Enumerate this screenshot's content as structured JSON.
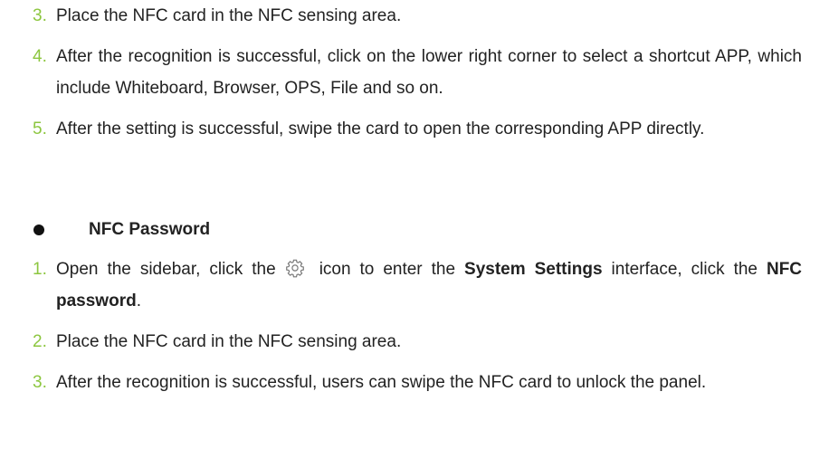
{
  "steps_before": [
    {
      "num": "3.",
      "text": "Place the NFC card in the NFC sensing area."
    },
    {
      "num": "4.",
      "text": "After the recognition is successful, click on the lower right corner to select a shortcut APP, which include Whiteboard, Browser, OPS, File and so on."
    },
    {
      "num": "5.",
      "text": "After the setting is successful, swipe the card to open the corresponding APP directly."
    }
  ],
  "section": {
    "title": "NFC Password"
  },
  "steps_after": {
    "s1": {
      "num": "1.",
      "pre": "Open the sidebar, click the",
      "icon": "gear-icon",
      "mid": "icon to enter the",
      "bold1": "System Settings",
      "post1": "interface, click the",
      "bold2": "NFC password",
      "end": "."
    },
    "s2": {
      "num": "2.",
      "text": "Place the NFC card in the NFC sensing area."
    },
    "s3": {
      "num": "3.",
      "text": "After the recognition is successful, users can swipe the NFC card to unlock the panel."
    }
  },
  "colors": {
    "step_number": "#8cc63f",
    "text": "#222222"
  }
}
